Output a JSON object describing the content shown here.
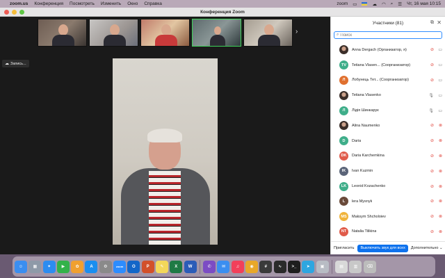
{
  "menubar": {
    "app_name": "zoom.us",
    "menus": [
      "Конференция",
      "Посмотреть",
      "Изменить",
      "Окно",
      "Справка"
    ],
    "zoom_label": "zoom",
    "datetime": "Чт, 16 мая  10:15"
  },
  "window": {
    "title": "Конференция Zoom"
  },
  "recording": {
    "label": "Запись..."
  },
  "participants": {
    "header": "Участники (81)",
    "search_placeholder": "Поиск",
    "list": [
      {
        "name": "Anna Dergach (Организатор, я)",
        "initials": "",
        "color": "",
        "photo": true,
        "mic": "muted",
        "cam": "on"
      },
      {
        "name": "Tetiana Vlasen...  (Соорганизатор)",
        "initials": "TV",
        "color": "#3fae8a",
        "photo": false,
        "mic": "muted",
        "cam": "on"
      },
      {
        "name": "Лобунець Тет...  (Соорганизатор)",
        "initials": "Л",
        "color": "#e0702f",
        "photo": false,
        "mic": "muted",
        "cam": "on"
      },
      {
        "name": "Tetiana Vlasenko",
        "initials": "",
        "color": "",
        "photo": true,
        "mic": "on",
        "cam": "on"
      },
      {
        "name": "Лідія Шинкарук",
        "initials": "Л",
        "color": "#3fae8a",
        "photo": false,
        "mic": "on",
        "cam": "on"
      },
      {
        "name": "Alina Naumenko",
        "initials": "",
        "color": "",
        "photo": true,
        "mic": "muted",
        "cam": "muted"
      },
      {
        "name": "Daria",
        "initials": "D",
        "color": "#3fae8a",
        "photo": false,
        "mic": "muted",
        "cam": "muted"
      },
      {
        "name": "Daria Karchemkina",
        "initials": "DK",
        "color": "#e05b4a",
        "photo": false,
        "mic": "muted",
        "cam": "muted"
      },
      {
        "name": "Ivan Kuzmin",
        "initials": "IK",
        "color": "#5a6478",
        "photo": false,
        "mic": "muted",
        "cam": "muted"
      },
      {
        "name": "Leonid Kozachenko",
        "initials": "LK",
        "color": "#3fae8a",
        "photo": false,
        "mic": "muted",
        "cam": "muted"
      },
      {
        "name": "lera Mysnyk",
        "initials": "L",
        "color": "#6a4a3a",
        "photo": false,
        "mic": "muted",
        "cam": "muted"
      },
      {
        "name": "Maksym Shcholoiev",
        "initials": "MS",
        "color": "#f0b33a",
        "photo": false,
        "mic": "muted",
        "cam": "muted"
      },
      {
        "name": "Natalia Tilikina",
        "initials": "NT",
        "color": "#e05b4a",
        "photo": false,
        "mic": "muted",
        "cam": "muted"
      }
    ]
  },
  "footer": {
    "invite": "Пригласить",
    "mute_all": "Выключить звук для всех",
    "more": "Дополнительно ⌄"
  },
  "dock": {
    "apps": [
      {
        "name": "finder-icon",
        "glyph": "☺",
        "color": "#3b8ef0"
      },
      {
        "name": "launchpad-icon",
        "glyph": "▦",
        "color": "#8e9aa8"
      },
      {
        "name": "safari-icon",
        "glyph": "✦",
        "color": "#2d8cf0"
      },
      {
        "name": "facetime-icon",
        "glyph": "▶",
        "color": "#33b24a"
      },
      {
        "name": "photos-icon",
        "glyph": "✿",
        "color": "#f0a030"
      },
      {
        "name": "app-store-icon",
        "glyph": "A",
        "color": "#1a8ef0"
      },
      {
        "name": "system-settings-icon",
        "glyph": "⚙",
        "color": "#8a8a8a"
      },
      {
        "name": "zoom-icon",
        "glyph": "zoom",
        "color": "#2d8cff"
      },
      {
        "name": "outlook-icon",
        "glyph": "O",
        "color": "#1366c8"
      },
      {
        "name": "powerpoint-icon",
        "glyph": "P",
        "color": "#d2502a"
      },
      {
        "name": "notes-icon",
        "glyph": "✎",
        "color": "#f3d75a"
      },
      {
        "name": "excel-icon",
        "glyph": "X",
        "color": "#1f7a45"
      },
      {
        "name": "word-icon",
        "glyph": "W",
        "color": "#2b5cb8"
      },
      {
        "name": "viber-icon",
        "glyph": "✆",
        "color": "#7c4cc4"
      },
      {
        "name": "mail-icon",
        "glyph": "✉",
        "color": "#3b8ef0"
      },
      {
        "name": "music-icon",
        "glyph": "♫",
        "color": "#f2405a"
      },
      {
        "name": "chrome-icon",
        "glyph": "◉",
        "color": "#e8a82a"
      },
      {
        "name": "calculator-icon",
        "glyph": "#",
        "color": "#3a3a3a"
      },
      {
        "name": "activity-monitor-icon",
        "glyph": "∿",
        "color": "#2a2a2a"
      },
      {
        "name": "terminal-icon",
        "glyph": ">_",
        "color": "#1e1e1e"
      },
      {
        "name": "telegram-icon",
        "glyph": "➤",
        "color": "#2ea6e0"
      },
      {
        "name": "preview-icon",
        "glyph": "▣",
        "color": "#b8bcc4"
      },
      {
        "name": "document-icon",
        "glyph": "▤",
        "color": "#d8d8d8"
      },
      {
        "name": "downloads-icon",
        "glyph": "▥",
        "color": "#c8c8c8"
      },
      {
        "name": "trash-icon",
        "glyph": "⌫",
        "color": "#bcbcbc"
      }
    ]
  }
}
